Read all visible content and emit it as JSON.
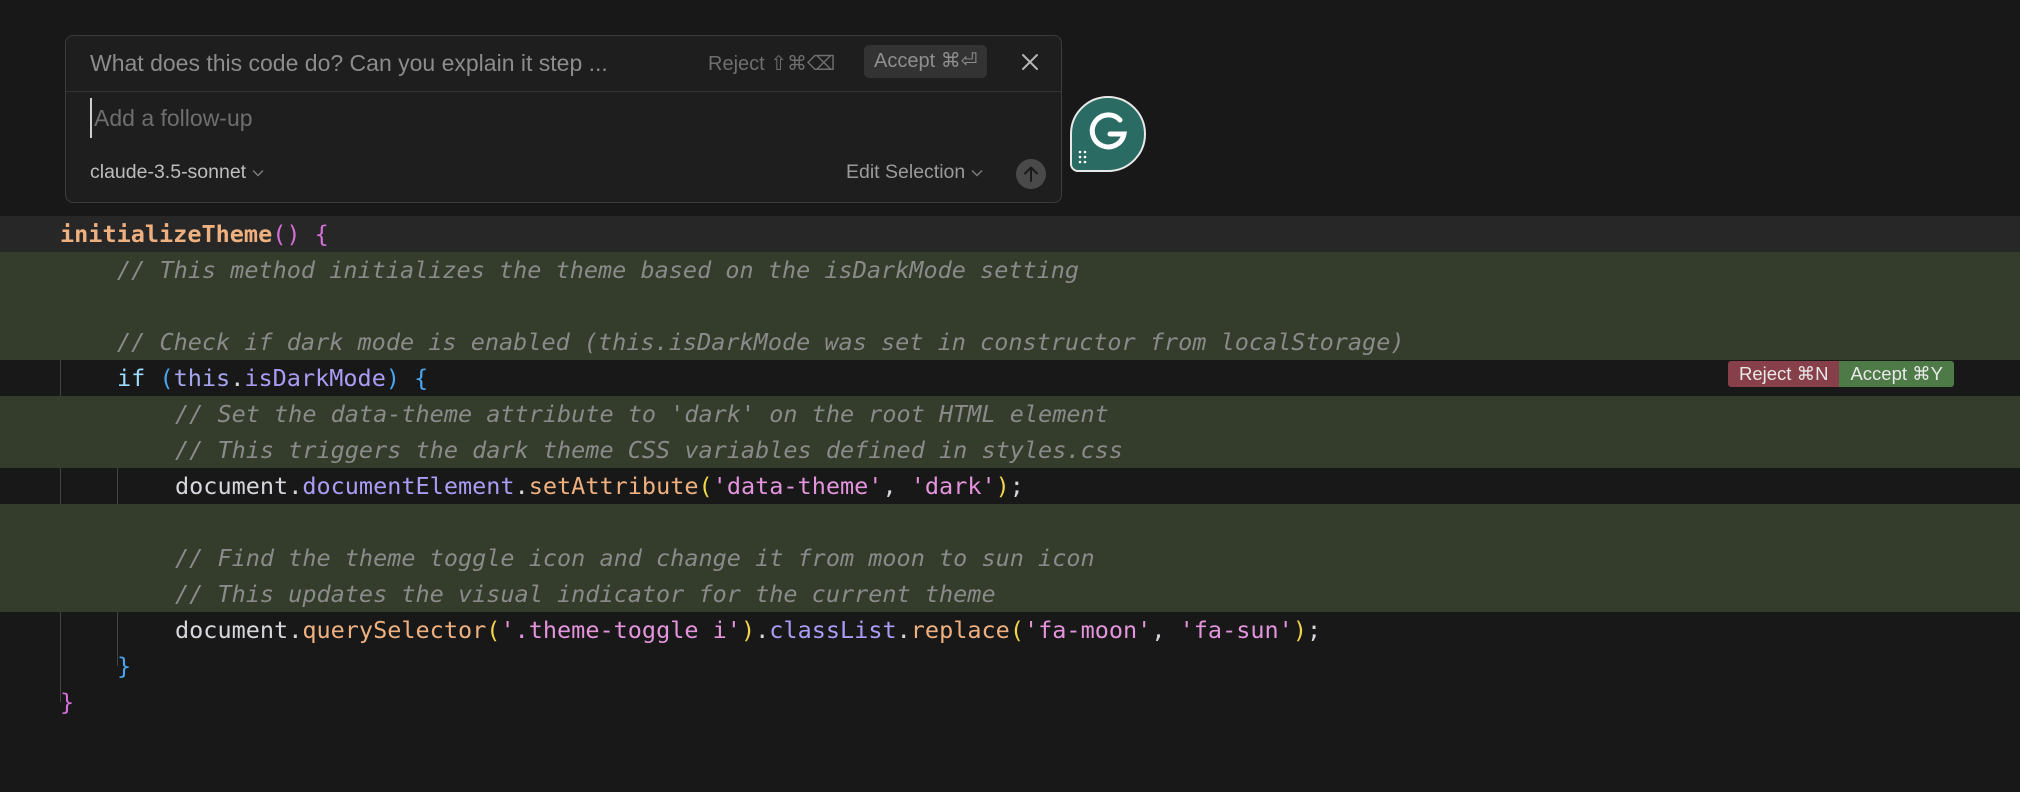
{
  "inline_chat": {
    "prompt": "What does this code do? Can you explain it step ...",
    "reject_label": "Reject ⇧⌘⌫",
    "accept_label": "Accept ⌘⏎",
    "followup_placeholder": "Add a follow-up",
    "model": "claude-3.5-sonnet",
    "mode": "Edit Selection",
    "icons": {
      "close": "close-icon",
      "submit": "arrow-up-icon",
      "chevron": "chevron-down-icon"
    }
  },
  "diff_actions": {
    "reject_label": "Reject ⌘N",
    "accept_label": "Accept ⌘Y"
  },
  "grammarly": {
    "icon": "grammarly-icon"
  },
  "code": {
    "line1": {
      "name": "initializeTheme",
      "parens": "()",
      "brace": " {"
    },
    "line2": "// This method initializes the theme based on the isDarkMode setting",
    "line4": "// Check if dark mode is enabled (this.isDarkMode was set in constructor from localStorage)",
    "line5": {
      "if": "if ",
      "open": "(",
      "this": "this",
      "dot": ".",
      "prop": "isDarkMode",
      "close": ")",
      "brace": " {"
    },
    "line6": "// Set the data-theme attribute to 'dark' on the root HTML element",
    "line7": "// This triggers the dark theme CSS variables defined in styles.css",
    "line8": {
      "obj": "document",
      "dot1": ".",
      "prop": "documentElement",
      "dot2": ".",
      "method": "setAttribute",
      "open": "(",
      "arg1": "'data-theme'",
      "comma": ", ",
      "arg2": "'dark'",
      "close": ")",
      "semi": ";"
    },
    "line10": "// Find the theme toggle icon and change it from moon to sun icon",
    "line11": "// This updates the visual indicator for the current theme",
    "line12": {
      "obj": "document",
      "dot1": ".",
      "method1": "querySelector",
      "open1": "(",
      "arg": "'.theme-toggle i'",
      "close1": ")",
      "dot2": ".",
      "prop": "classList",
      "dot3": ".",
      "method2": "replace",
      "open2": "(",
      "arg1": "'fa-moon'",
      "comma": ", ",
      "arg2": "'fa-sun'",
      "close2": ")",
      "semi": ";"
    },
    "line13": "}",
    "line14": "}"
  },
  "colors": {
    "editor_bg": "#181818",
    "added_line_bg": "#343d2b",
    "reject_bg": "#874049",
    "accept_bg": "#4e7a48",
    "grammarly": "#2a6c63"
  }
}
